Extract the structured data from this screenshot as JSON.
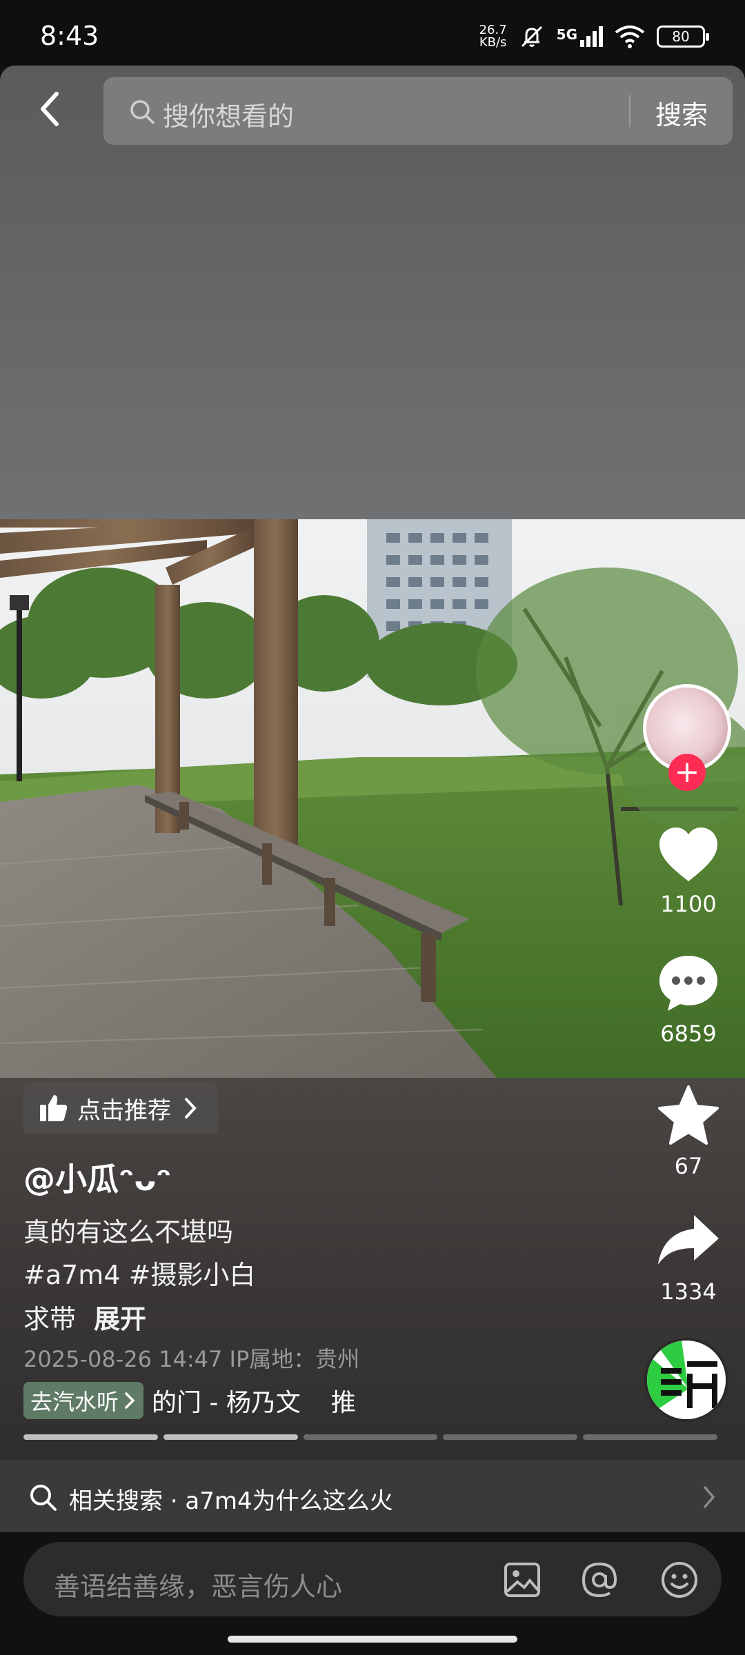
{
  "status_bar": {
    "time": "8:43",
    "net_speed_value": "26.7",
    "net_speed_unit": "KB/s",
    "network": "5G",
    "battery": "80"
  },
  "header": {
    "search_placeholder": "搜你想看的",
    "search_button": "搜索"
  },
  "sidebar": {
    "likes": "1100",
    "comments": "6859",
    "favorites": "67",
    "shares": "1334"
  },
  "post": {
    "recommend_label": "点击推荐",
    "author": "@小瓜ᵔᴗᵔ",
    "caption_line1": "真的有这么不堪吗",
    "caption_tags": "#a7m4 #摄影小白",
    "caption_line3": "求带",
    "expand_label": "展开",
    "meta": "2025-08-26 14:47  IP属地：贵州",
    "music_chip": "去汽水听",
    "music_text": "的门 - 杨乃文",
    "music_extra": "推",
    "progress_segments": 5,
    "progress_done": 2
  },
  "related_search": {
    "text": "相关搜索 · a7m4为什么这么火"
  },
  "comment_bar": {
    "placeholder": "善语结善缘，恶言伤人心"
  },
  "colors": {
    "follow_red": "#fe2c55",
    "music_chip_green": "#5f7b66"
  }
}
